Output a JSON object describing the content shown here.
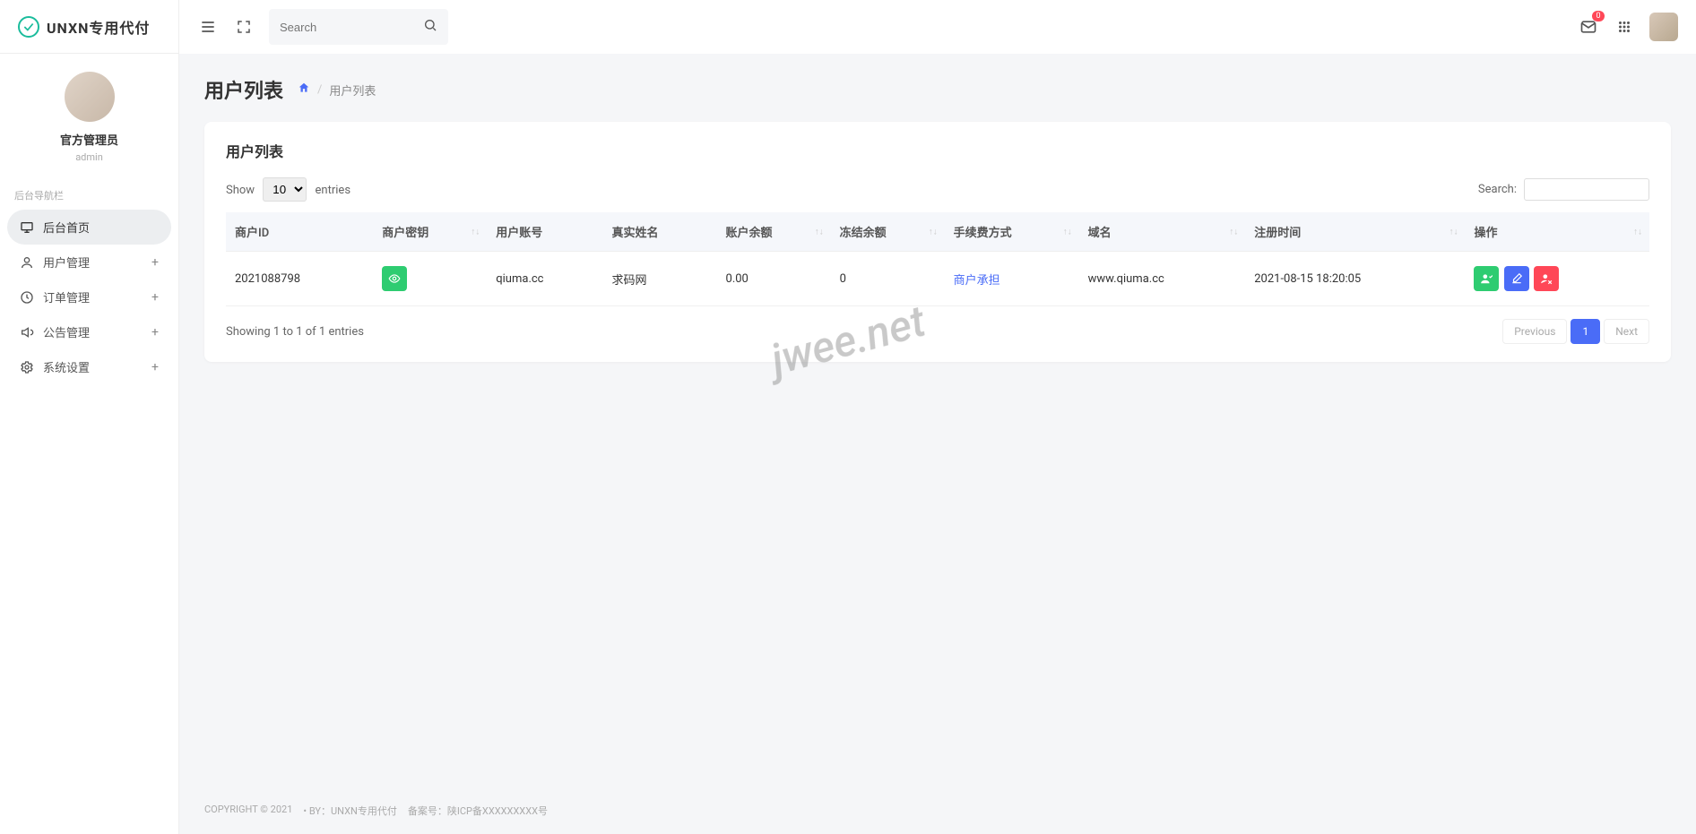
{
  "brand": "UNXN专用代付",
  "profile": {
    "name": "官方管理员",
    "role": "admin"
  },
  "nav": {
    "header": "后台导航栏",
    "items": [
      {
        "label": "后台首页",
        "expandable": false
      },
      {
        "label": "用户管理",
        "expandable": true
      },
      {
        "label": "订单管理",
        "expandable": true
      },
      {
        "label": "公告管理",
        "expandable": true
      },
      {
        "label": "系统设置",
        "expandable": true
      }
    ]
  },
  "topbar": {
    "search_placeholder": "Search",
    "notification_badge": "0"
  },
  "page": {
    "title": "用户列表",
    "breadcrumb_current": "用户列表"
  },
  "card": {
    "title": "用户列表",
    "show_label": "Show",
    "entries_label": "entries",
    "page_size": "10",
    "search_label": "Search:",
    "columns": [
      "商户ID",
      "商户密钥",
      "用户账号",
      "真实姓名",
      "账户余额",
      "冻结余额",
      "手续费方式",
      "域名",
      "注册时间",
      "操作"
    ],
    "row": {
      "merchant_id": "2021088798",
      "account": "qiuma.cc",
      "realname": "求码网",
      "balance": "0.00",
      "frozen": "0",
      "fee_mode": "商户承担",
      "domain": "www.qiuma.cc",
      "reg_time": "2021-08-15 18:20:05"
    },
    "info": "Showing 1 to 1 of 1 entries",
    "pager": {
      "prev": "Previous",
      "page": "1",
      "next": "Next"
    }
  },
  "footer": {
    "copyright": "COPYRIGHT © 2021",
    "by": "• BY：UNXN专用代付",
    "record": "备案号：陕ICP备XXXXXXXXX号"
  },
  "watermark": "jwee.net"
}
